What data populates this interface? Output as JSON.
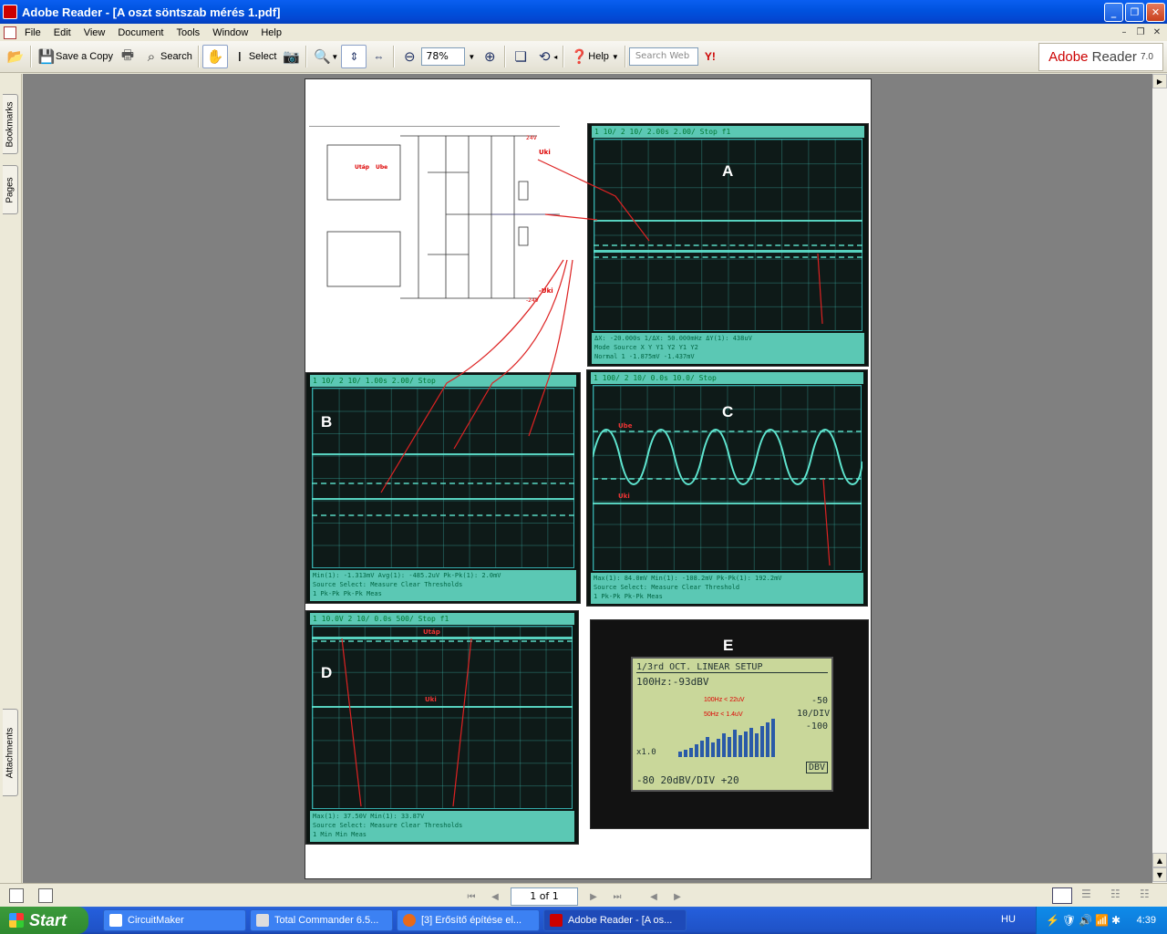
{
  "window": {
    "title": "Adobe Reader - [A oszt söntszab mérés 1.pdf]"
  },
  "menu": [
    "File",
    "Edit",
    "View",
    "Document",
    "Tools",
    "Window",
    "Help"
  ],
  "toolbar": {
    "save_copy": "Save a Copy",
    "search": "Search",
    "select": "Select",
    "zoom": "78%",
    "help": "Help",
    "search_web_placeholder": "Search Web"
  },
  "logo": {
    "brand": "Adobe",
    "product": "Reader",
    "version": "7.0"
  },
  "nav_tabs": [
    "Bookmarks",
    "Pages",
    "Attachments"
  ],
  "page_nav": {
    "current": "1 of 1"
  },
  "scopes": {
    "a": {
      "label": "A",
      "header": "1  10/  2  10/     2.00s   2.00/  Stop  f1",
      "foot1": "ΔX: -20.000s    1/ΔX: 50.000mHz    ΔY(1): 438uV",
      "foot2": "Mode  Source  X  Y   Y1  Y2  Y1 Y2",
      "foot3": "Normal  1              -1.875mV  -1.437mV"
    },
    "b": {
      "label": "B",
      "header": "1  10/  2  10/     1.00s   2.00/  Stop",
      "foot1": "Min(1): -1.313mV    Avg(1): -485.2uV    Pk-Pk(1): 2.0mV",
      "foot2": "Source  Select:  Measure  Clear    Thresholds",
      "foot3": "1       Pk-Pk    Pk-Pk    Meas"
    },
    "c": {
      "label": "C",
      "header": "1  100/  2  10/     0.0s   10.0/  Stop",
      "foot1": "Max(1): 84.0mV    Min(1): -108.2mV    Pk-Pk(1): 192.2mV",
      "foot2": "Source  Select:  Measure  Clear    Threshold",
      "foot3": "1       Pk-Pk    Pk-Pk    Meas",
      "ube": "Ube",
      "uki": "Uki"
    },
    "d": {
      "label": "D",
      "header": "1  10.0V  2  10/     0.0s   500/  Stop  f1",
      "foot1": "Max(1): 37.50V    Min(1): 33.87V",
      "foot2": "Source  Select:  Measure  Clear    Thresholds",
      "foot3": "1       Min      Min      Meas",
      "utap": "Utáp",
      "uki": "Uki"
    }
  },
  "lcd": {
    "label": "E",
    "tabs": "1/3rd OCT. LINEAR SETUP",
    "readout": "100Hz:-93dBV",
    "note1": "100Hz < 22uV",
    "note2": "50Hz  < 1.4uV",
    "right_scale": "-50  10/DIV  -100",
    "mult": "x1.0",
    "scale": "-80   20dBV/DIV  +20",
    "dbv": "DBV"
  },
  "schematic": {
    "uki_top": "Uki",
    "uki_bottom": "-Uki",
    "utap": "Utáp",
    "ube": "Ube",
    "vplus": "24V",
    "vminus": "-24V"
  },
  "taskbar": {
    "start": "Start",
    "tasks": [
      "CircuitMaker",
      "Total Commander 6.5...",
      "[3] Erősítő építése el...",
      "Adobe Reader - [A os..."
    ],
    "lang": "HU",
    "clock": "4:39"
  },
  "colors": {
    "title_blue": "#0a5ff1",
    "taskbar_blue": "#245edb",
    "start_green": "#3c9a3c",
    "trace": "#5fe6d0"
  }
}
